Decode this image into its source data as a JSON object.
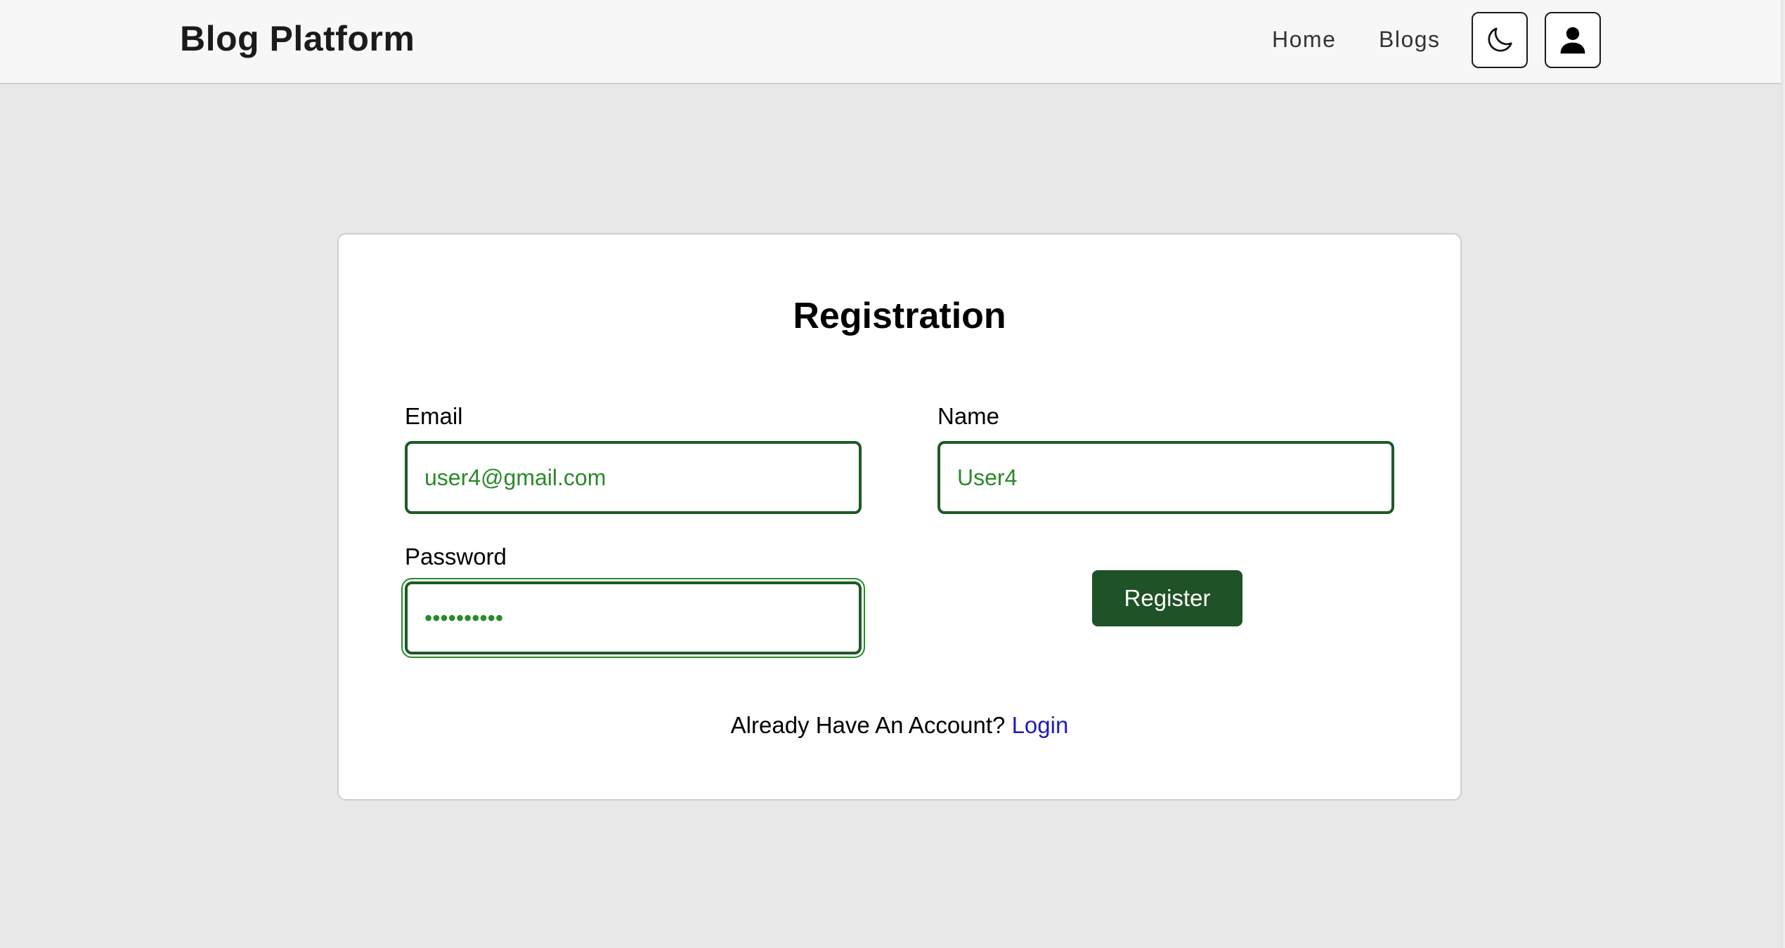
{
  "header": {
    "brand": "Blog Platform",
    "nav": {
      "home": "Home",
      "blogs": "Blogs"
    },
    "icons": {
      "theme_toggle": "moon-icon",
      "account": "user-icon"
    }
  },
  "form": {
    "title": "Registration",
    "email": {
      "label": "Email",
      "value": "user4@gmail.com"
    },
    "name": {
      "label": "Name",
      "value": "User4"
    },
    "password": {
      "label": "Password",
      "value": "••••••••••"
    },
    "submit_label": "Register",
    "footer_text": "Already Have An Account?",
    "login_link": "Login"
  },
  "colors": {
    "primary_button": "#1f5226",
    "input_border": "#1e5a27",
    "input_text": "#2a8a2a",
    "link": "#1d1db8",
    "page_background": "#e8e8e8"
  }
}
